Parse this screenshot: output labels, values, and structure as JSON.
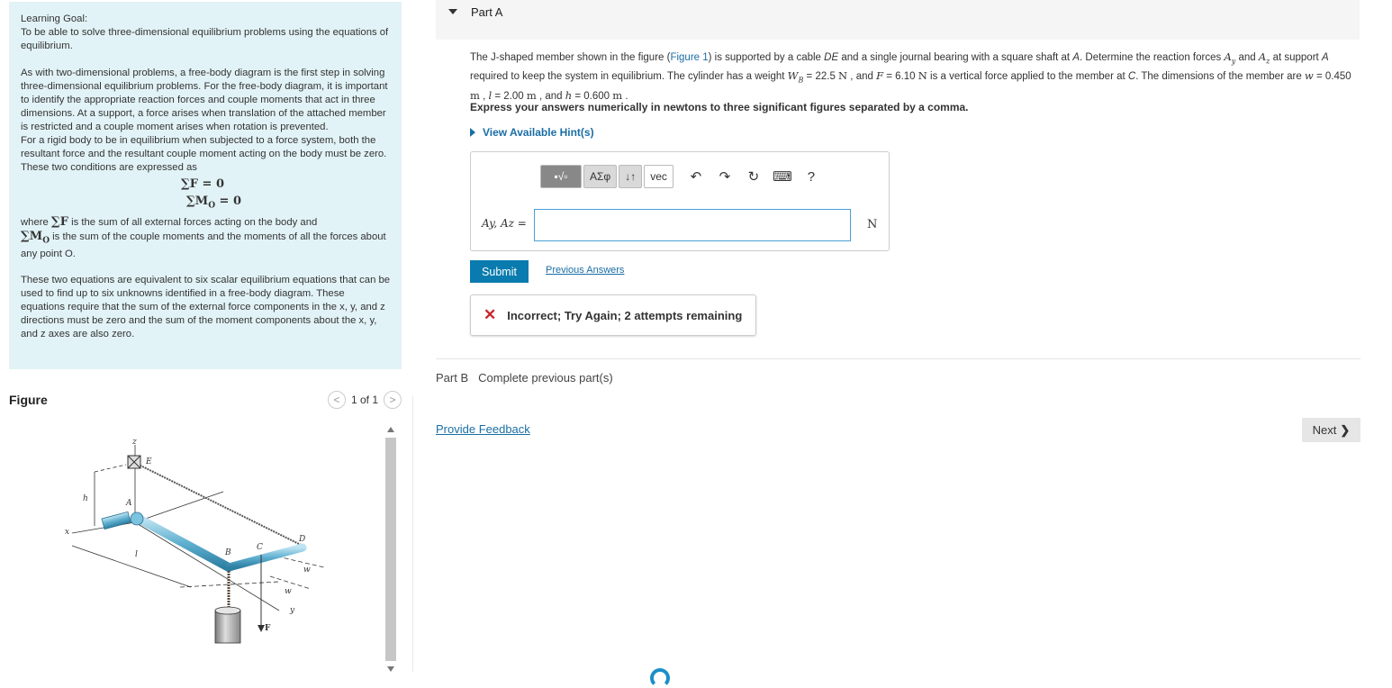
{
  "learning": {
    "heading": "Learning Goal:",
    "goal": "To be able to solve three-dimensional equilibrium problems using the equations of equilibrium.",
    "para1": "As with two-dimensional problems, a free-body diagram is the first step in solving three-dimensional equilibrium problems. For the free-body diagram, it is important to identify the appropriate reaction forces and couple moments that act in three dimensions. At a support, a force arises when translation of the attached member is restricted and a couple moment arises when rotation is prevented.",
    "para2": "For a rigid body to be in equilibrium when subjected to a force system, both the resultant force and the resultant couple moment acting on the body must be zero. These two conditions are expressed as",
    "eq1": "∑F = 0",
    "eq2": "∑M",
    "eq2_sub": "O",
    "eq2_rest": " = 0",
    "where_prefix": "where ",
    "where_sumF": "∑F",
    "where_text1": " is the sum of all external forces acting on the body and",
    "where_sumM": "∑M",
    "where_sumM_sub": "O",
    "where_text2": " is the sum of the couple moments and the moments of all the forces about any point O.",
    "para3": "These two equations are equivalent to six scalar equilibrium equations that can be used to find up to six unknowns identified in a free-body diagram. These equations require that the sum of the external force components in the x, y, and z directions must be zero and the sum of the moment components about the x, y, and z axes are also zero."
  },
  "figure": {
    "title": "Figure",
    "pager": "1 of 1",
    "labels": {
      "z": "z",
      "E": "E",
      "h": "h",
      "A": "A",
      "x": "x",
      "l": "l",
      "B": "B",
      "C": "C",
      "D": "D",
      "w1": "w",
      "w2": "w",
      "F": "F",
      "y": "y"
    }
  },
  "partA": {
    "label": "Part A",
    "problem_1": "The J-shaped member shown in the figure (",
    "figure_link": "Figure 1",
    "problem_2": ") is supported by a cable ",
    "DE": "DE",
    "problem_3": " and a single journal bearing with a square shaft at ",
    "A": "A",
    "problem_4": ". Determine the reaction forces ",
    "Ay": "A",
    "Ay_sub": "y",
    "and": " and ",
    "Az": "A",
    "Az_sub": "z",
    "problem_5": " at support ",
    "problem_6": " required to keep the system in equilibrium. The cylinder has a weight ",
    "WB": "W",
    "WB_sub": "B",
    "WB_val": " = 22.5 ",
    "N1": "N",
    "and_F": " , and ",
    "F": "F",
    "F_val": " = 6.10 ",
    "N2": "N",
    "problem_7": " is a vertical force applied to the member at ",
    "C": "C",
    "problem_8": ". The dimensions of the member are ",
    "w": "w",
    "w_val": " = 0.450 ",
    "m1": "m",
    "comma1": " , ",
    "l": "l",
    "l_val": " = 2.00 ",
    "m2": "m",
    "and_h": " , and ",
    "h": "h",
    "h_val": " = 0.600 ",
    "m3": "m",
    "period": " .",
    "instruction": "Express your answers numerically in newtons to three significant figures separated by a comma.",
    "hint": "View Available Hint(s)",
    "toolbar": {
      "templates": "▪√▫",
      "greek": "ΑΣφ",
      "arrows": "↓↑",
      "vec": "vec",
      "undo": "↶",
      "redo": "↷",
      "reset": "↻",
      "keyboard": "⌨",
      "help": "?"
    },
    "answer_label": "Ay, Az =",
    "answer_value": "",
    "unit": "N",
    "submit": "Submit",
    "previous": "Previous Answers",
    "feedback_icon": "✕",
    "feedback": "Incorrect; Try Again; 2 attempts remaining"
  },
  "partB": {
    "label": "Part B",
    "status": "Complete previous part(s)"
  },
  "footer": {
    "provide_feedback": "Provide Feedback",
    "next": "Next"
  }
}
